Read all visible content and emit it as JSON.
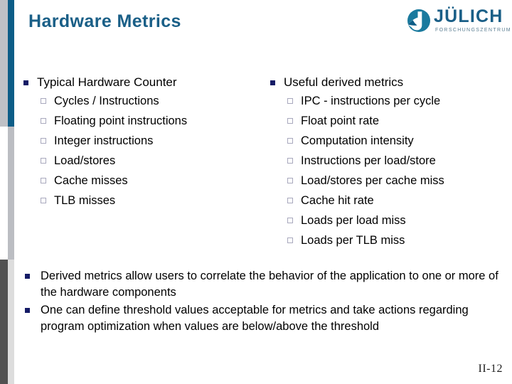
{
  "slide": {
    "title": "Hardware Metrics",
    "page_number": "II-12"
  },
  "logo": {
    "mark": "juelich-swoosh-icon",
    "wordmark": "JÜLICH",
    "subtitle": "FORSCHUNGSZENTRUM",
    "color": "#1a5f87"
  },
  "colors": {
    "title": "#1a5f87",
    "accent_teal": "#0d5d87",
    "bullet_level1": "#151b66",
    "bullet_level2_border": "#a8a8bd",
    "edge_light_gray": "#bfc1c6",
    "edge_mid_gray": "#bbbdc2",
    "edge_dark_gray": "#515151",
    "edge_pale_gray": "#dddddd",
    "body_text": "#000000"
  },
  "columns": {
    "left": {
      "heading": "Typical Hardware Counter",
      "items": [
        "Cycles / Instructions",
        "Floating point instructions",
        "Integer instructions",
        "Load/stores",
        "Cache misses",
        "TLB misses"
      ]
    },
    "right": {
      "heading": "Useful derived metrics",
      "items": [
        "IPC - instructions per cycle",
        "Float point rate",
        "Computation intensity",
        "Instructions per load/store",
        "Load/stores per cache miss",
        "Cache hit rate",
        "Loads per load miss",
        "Loads per TLB miss"
      ]
    }
  },
  "bottom_points": [
    "Derived metrics allow users to correlate the behavior of the application to one or more of the hardware components",
    "One can define threshold values acceptable for metrics and take actions regarding program optimization when values are below/above the threshold"
  ]
}
